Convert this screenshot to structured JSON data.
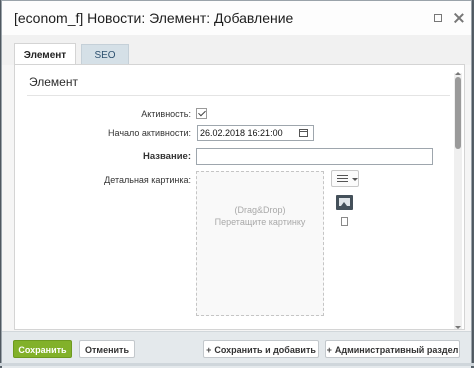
{
  "window": {
    "title": "[econom_f] Новости: Элемент: Добавление",
    "maximize_icon": "maximize-icon",
    "close_icon": "close-icon"
  },
  "tabs": [
    {
      "label": "Элемент",
      "active": true
    },
    {
      "label": "SEO",
      "active": false
    }
  ],
  "section": {
    "title": "Элемент"
  },
  "fields": {
    "active": {
      "label": "Активность:",
      "checked": true
    },
    "start_date": {
      "label": "Начало активности:",
      "value": "26.02.2018 16:21:00",
      "icon": "calendar-icon"
    },
    "name": {
      "label": "Название:",
      "value": ""
    },
    "detail_picture": {
      "label": "Детальная картинка:",
      "dropzone_line1": "(Drag&Drop)",
      "dropzone_line2": "Перетащите картинку",
      "menu_icon": "menu-icon",
      "image_icon": "image-icon",
      "file_icon": "file-icon"
    }
  },
  "footer": {
    "save": "Сохранить",
    "cancel": "Отменить",
    "save_add": "Сохранить и добавить",
    "admin": "Административный раздел",
    "plus": "+"
  },
  "colors": {
    "save_button": "#82b12a",
    "tab_seo": "#d5e0e7"
  }
}
